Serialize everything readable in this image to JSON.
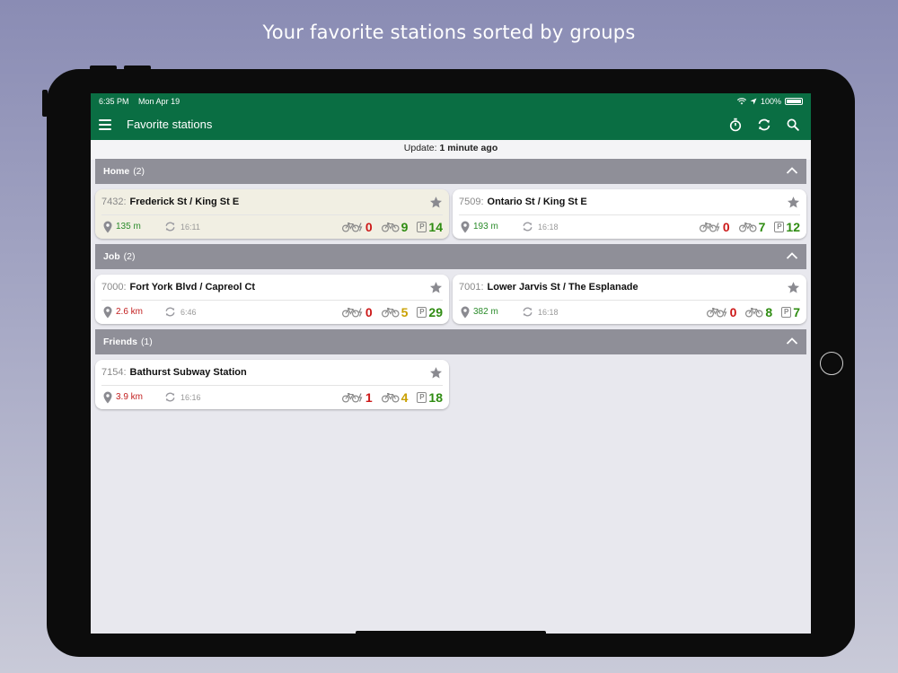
{
  "caption": "Your favorite stations sorted by groups",
  "statusbar": {
    "time": "6:35 PM",
    "date": "Mon Apr 19",
    "battery": "100%"
  },
  "appbar": {
    "title": "Favorite stations"
  },
  "update": {
    "label": "Update:",
    "value": "1 minute ago"
  },
  "groups": [
    {
      "name": "Home",
      "count": "(2)"
    },
    {
      "name": "Job",
      "count": "(2)"
    },
    {
      "name": "Friends",
      "count": "(1)"
    }
  ],
  "stations": [
    {
      "id": "7432:",
      "name": "Frederick St / King St E",
      "distance": "135 m",
      "updated": "16:11",
      "ebikes": "0",
      "bikes": "9",
      "docks": "14"
    },
    {
      "id": "7509:",
      "name": "Ontario St / King St E",
      "distance": "193 m",
      "updated": "16:18",
      "ebikes": "0",
      "bikes": "7",
      "docks": "12"
    },
    {
      "id": "7000:",
      "name": "Fort York Blvd / Capreol Ct",
      "distance": "2.6 km",
      "updated": "6:46",
      "ebikes": "0",
      "bikes": "5",
      "docks": "29"
    },
    {
      "id": "7001:",
      "name": "Lower Jarvis St / The Esplanade",
      "distance": "382 m",
      "updated": "16:18",
      "ebikes": "0",
      "bikes": "8",
      "docks": "7"
    },
    {
      "id": "7154:",
      "name": "Bathurst Subway Station",
      "distance": "3.9 km",
      "updated": "16:16",
      "ebikes": "1",
      "bikes": "4",
      "docks": "18"
    }
  ],
  "icons": {
    "menu": "menu-icon",
    "timer": "stopwatch-icon",
    "refresh": "refresh-icon",
    "search": "search-icon",
    "collapse": "chevron-up-icon",
    "favorite": "star-icon",
    "location": "location-pin-icon",
    "updated": "sync-icon",
    "ebike": "electric-bike-icon",
    "bike": "bike-icon",
    "dock": "parking-icon"
  },
  "colors": {
    "appbar": "#0a6e43",
    "group_header": "#8f8f98",
    "highlight_card": "#f1efe3",
    "red": "#cc1818",
    "green": "#2f8c12",
    "yellow": "#c9a000"
  }
}
